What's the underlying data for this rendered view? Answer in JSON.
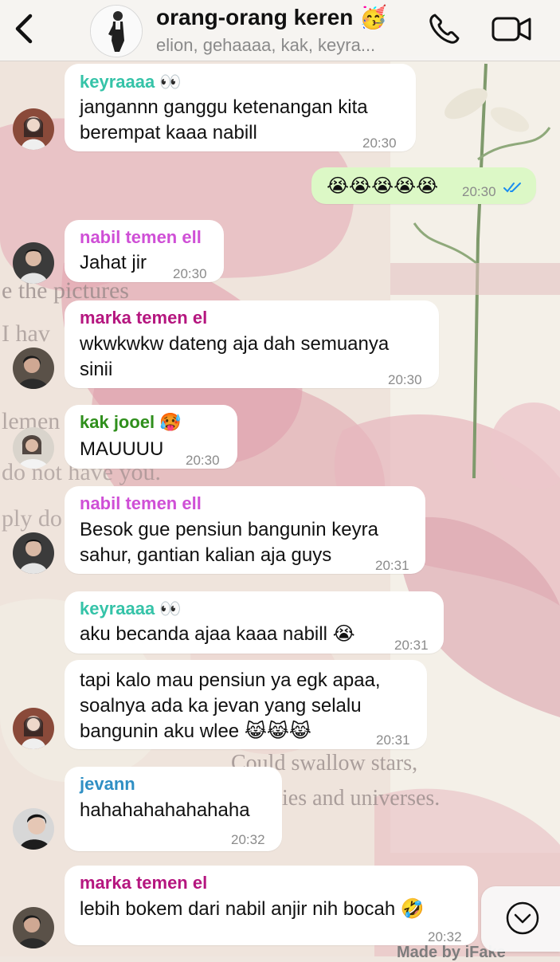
{
  "header": {
    "title": "orang-orang keren",
    "title_emoji": "🥳",
    "subtitle": "elion, gehaaaa, kak, keyra..."
  },
  "messages": [
    {
      "sender": "keyraaaa",
      "sender_emoji": "👀",
      "lines": [
        "jangannn ganggu ketenangan kita",
        "berempat kaaa nabill"
      ],
      "time": "20:30"
    },
    {
      "outgoing": true,
      "text": "😭😭😭😭😭",
      "time": "20:30",
      "status": "read"
    },
    {
      "sender": "nabil temen ell",
      "lines": [
        "Jahat jir"
      ],
      "time": "20:30"
    },
    {
      "sender": "marka temen el",
      "lines": [
        "wkwkwkw dateng aja dah semuanya",
        "sinii"
      ],
      "time": "20:30"
    },
    {
      "sender": "kak jooel",
      "sender_emoji": "🥵",
      "lines": [
        "MAUUUU"
      ],
      "time": "20:30"
    },
    {
      "sender": "nabil temen ell",
      "lines": [
        "Besok gue pensiun bangunin keyra",
        "sahur, gantian kalian aja guys"
      ],
      "time": "20:31"
    },
    {
      "sender": "keyraaaa",
      "sender_emoji": "👀",
      "lines": [
        "aku becanda ajaa kaaa nabill 😭"
      ],
      "time": "20:31"
    },
    {
      "lines": [
        "tapi kalo mau pensiun ya egk apaa,",
        "soalnya ada ka jevan yang selalu",
        "bangunin aku wlee 😹😹😹"
      ],
      "time": "20:31"
    },
    {
      "sender": "jevann",
      "lines": [
        "hahahahahahahaha"
      ],
      "time": "20:32"
    },
    {
      "sender": "marka temen el",
      "lines": [
        "lebih bokem dari nabil anjir nih bocah 🤣"
      ],
      "time": "20:32"
    }
  ],
  "wallpaper_text": [
    "e the pictures",
    "I hav",
    "lemen",
    "do not have you.",
    "ply do",
    "Could swallow stars,",
    "kies and universes."
  ],
  "watermark": "Made by iFake",
  "colors": {
    "keyraaaa": "#35c3a8",
    "nabil temen ell": "#cf4fd6",
    "marka temen el": "#b5167f",
    "kak jooel": "#2f8f1c",
    "jevann": "#2f8fc4",
    "accent_blue": "#1a8cf0"
  }
}
